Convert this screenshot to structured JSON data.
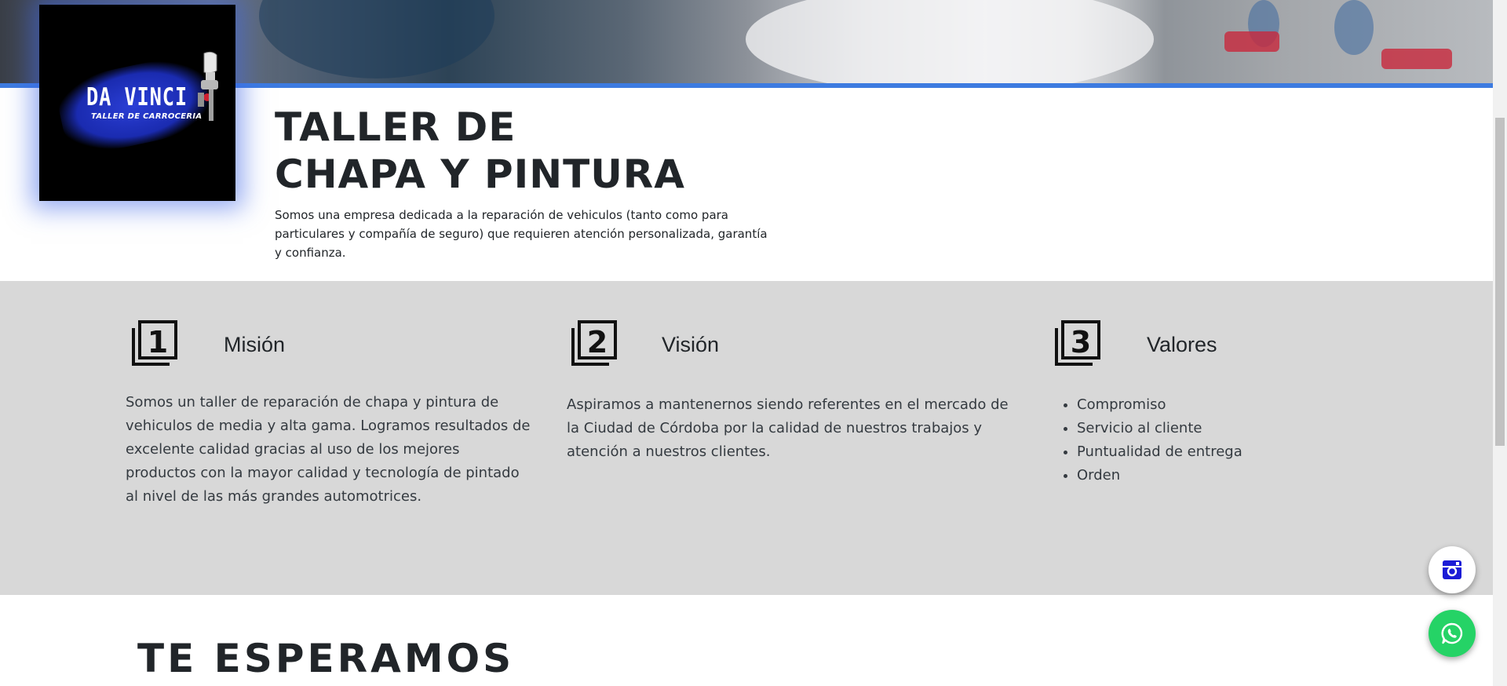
{
  "logo": {
    "name": "DA VINCI",
    "tagline": "TALLER DE CARROCERIA"
  },
  "intro": {
    "title_line1": "TALLER DE",
    "title_line2": "CHAPA Y PINTURA",
    "description": "Somos una empresa dedicada a la reparación de vehiculos (tanto como para particulares y compañía de seguro) que requieren atención personalizada, garantía y confianza."
  },
  "features": {
    "mission": {
      "number": "1",
      "title": "Misión",
      "text": "Somos un taller de reparación de chapa y pintura de vehiculos de media y alta gama. Logramos resultados de excelente calidad gracias al uso de los mejores productos con la mayor calidad y tecnología de pintado al nivel de las más grandes automotrices."
    },
    "vision": {
      "number": "2",
      "title": "Visión",
      "text": "Aspiramos a mantenernos siendo referentes en el mercado de la Ciudad de Córdoba por la calidad de nuestros trabajos y atención a nuestros clientes."
    },
    "values": {
      "number": "3",
      "title": "Valores",
      "items": [
        "Compromiso",
        "Servicio al cliente",
        "Puntualidad de entrega",
        "Orden"
      ]
    }
  },
  "welcome": {
    "title": "TE ESPERAMOS"
  },
  "floating": {
    "instagram_icon": "instagram-icon",
    "whatsapp_icon": "whatsapp-icon"
  },
  "colors": {
    "accent_blue": "#3d7be0",
    "section_gray": "#d8d8d8",
    "whatsapp_green": "#25d366",
    "instagram_blue": "#1b1bd6"
  }
}
